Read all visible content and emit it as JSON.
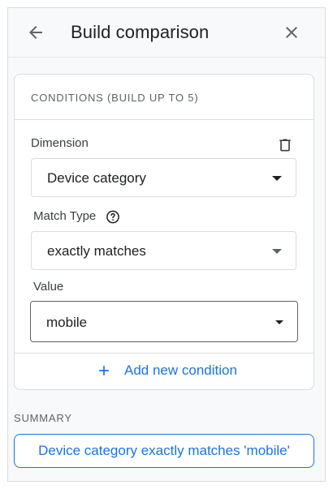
{
  "header": {
    "title": "Build comparison",
    "back_icon": "arrow-back-icon",
    "close_icon": "close-icon"
  },
  "conditions": {
    "heading": "CONDITIONS (BUILD UP TO 5)",
    "dimension": {
      "label": "Dimension",
      "value": "Device category"
    },
    "match_type": {
      "label": "Match Type",
      "value": "exactly matches"
    },
    "value_field": {
      "label": "Value",
      "value": "mobile"
    },
    "add_condition_label": "Add new condition"
  },
  "summary": {
    "heading": "SUMMARY",
    "text": "Device category exactly matches 'mobile'"
  },
  "colors": {
    "accent": "#1a73e8",
    "border": "#dadce0",
    "panel_bg": "#f8f9fa"
  }
}
